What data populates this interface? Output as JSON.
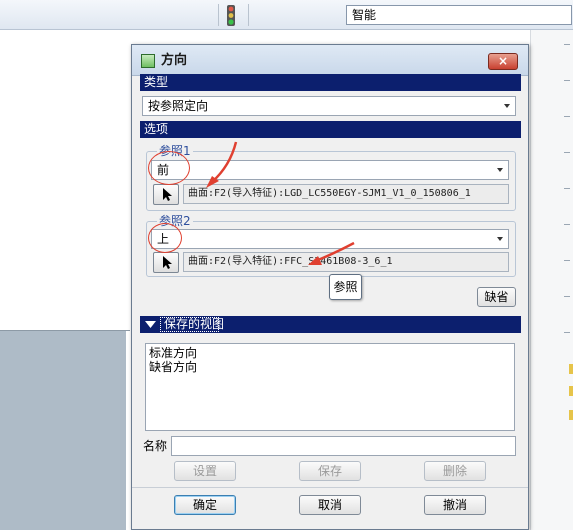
{
  "toolbar": {
    "filter_value": "智能"
  },
  "dialog": {
    "title": "方向",
    "close_glyph": "×",
    "type_section": {
      "header": "类型",
      "selected": "按参照定向"
    },
    "options_section": {
      "header": "选项",
      "reference1": {
        "label": "参照1",
        "orientation": "前",
        "reference_text": "曲面:F2(导入特征):LGD_LC550EGY-SJM1_V1_0_150806_1"
      },
      "reference2": {
        "label": "参照2",
        "orientation": "上",
        "reference_text": "曲面:F2(导入特征):FFC_S3461B08-3_6_1"
      },
      "tooltip": "参照",
      "default_button": "缺省"
    },
    "saved_views_section": {
      "header": "保存的视图",
      "items": [
        "标准方向",
        "缺省方向"
      ],
      "name_label": "名称",
      "name_value": "",
      "set_button": "设置",
      "save_button": "保存",
      "delete_button": "删除"
    },
    "footer": {
      "ok_button": "确定",
      "cancel_button": "取消",
      "undo_button": "撤消"
    }
  }
}
